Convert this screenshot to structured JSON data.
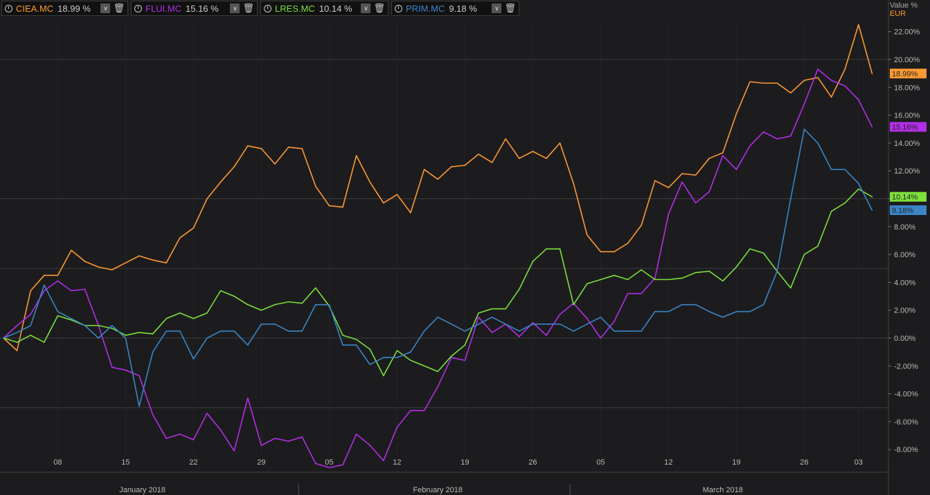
{
  "legend": [
    {
      "symbol": "CIEA.MC",
      "value": "18.99 %",
      "color": "#ff9a32"
    },
    {
      "symbol": "FLUI.MC",
      "value": "15.16 %",
      "color": "#b42ee8"
    },
    {
      "symbol": "LRES.MC",
      "value": "10.14 %",
      "color": "#7ee03c"
    },
    {
      "symbol": "PRIM.MC",
      "value": "9.18 %",
      "color": "#3a86c8"
    }
  ],
  "axis_header": {
    "label": "Value %",
    "currency": "EUR"
  },
  "chart_data": {
    "type": "line",
    "ylabel": "Value %",
    "ylim": [
      -9.5,
      24
    ],
    "yticks": [
      22,
      20,
      18,
      16,
      14,
      12,
      10,
      8,
      6,
      4,
      2,
      0,
      -2,
      -4,
      -6,
      -8
    ],
    "ytick_labels": [
      "22.00%",
      "20.00%",
      "18.00%",
      "16.00%",
      "14.00%",
      "12.00%",
      "10.00%",
      "8.00%",
      "6.00%",
      "4.00%",
      "2.00%",
      "0.00%",
      "-2.00%",
      "-4.00%",
      "-6.00%",
      "-8.00%"
    ],
    "xticks": [
      {
        "i": 4,
        "label": "08"
      },
      {
        "i": 9,
        "label": "15"
      },
      {
        "i": 14,
        "label": "22"
      },
      {
        "i": 19,
        "label": "29"
      },
      {
        "i": 24,
        "label": "05"
      },
      {
        "i": 29,
        "label": "12"
      },
      {
        "i": 34,
        "label": "19"
      },
      {
        "i": 39,
        "label": "26"
      },
      {
        "i": 44,
        "label": "05"
      },
      {
        "i": 49,
        "label": "12"
      },
      {
        "i": 54,
        "label": "19"
      },
      {
        "i": 59,
        "label": "26"
      },
      {
        "i": 63,
        "label": "03"
      }
    ],
    "months": [
      {
        "label": "January 2018",
        "from": 0,
        "to": 22
      },
      {
        "label": "February 2018",
        "from": 22,
        "to": 42
      },
      {
        "label": "March 2018",
        "from": 42,
        "to": 64
      }
    ],
    "series": [
      {
        "name": "CIEA.MC",
        "color": "#ff9a32",
        "last_label": "18.99%",
        "values": [
          0,
          -0.9,
          3.4,
          4.5,
          4.5,
          6.3,
          5.5,
          5.1,
          4.9,
          5.4,
          5.9,
          5.6,
          5.4,
          7.2,
          7.9,
          10.0,
          11.2,
          12.3,
          13.8,
          13.6,
          12.5,
          13.7,
          13.6,
          10.9,
          9.5,
          9.4,
          13.1,
          11.2,
          9.7,
          10.3,
          9.0,
          12.1,
          11.4,
          12.3,
          12.4,
          13.2,
          12.6,
          14.3,
          12.9,
          13.4,
          12.9,
          14.0,
          11.1,
          7.4,
          6.2,
          6.2,
          6.8,
          8.1,
          11.3,
          10.8,
          11.8,
          11.7,
          12.9,
          13.3,
          16.1,
          18.4,
          18.3,
          18.3,
          17.6,
          18.5,
          18.7,
          17.3,
          19.3,
          22.5,
          18.99
        ]
      },
      {
        "name": "FLUI.MC",
        "color": "#b42ee8",
        "last_label": "15.16%",
        "values": [
          0,
          0.9,
          1.7,
          3.4,
          4.1,
          3.4,
          3.5,
          0.9,
          -2.1,
          -2.3,
          -2.7,
          -5.5,
          -7.2,
          -6.9,
          -7.3,
          -5.4,
          -6.6,
          -8.1,
          -4.3,
          -7.7,
          -7.2,
          -7.4,
          -7.1,
          -9.0,
          -9.3,
          -9.1,
          -6.9,
          -7.7,
          -8.8,
          -6.4,
          -5.2,
          -5.2,
          -3.5,
          -1.4,
          -1.6,
          1.5,
          0.4,
          1.0,
          0.1,
          1.1,
          0.2,
          1.7,
          2.5,
          1.4,
          0,
          1.2,
          3.2,
          3.2,
          4.3,
          8.9,
          11.2,
          9.7,
          10.5,
          13.1,
          12.1,
          13.8,
          14.8,
          14.3,
          14.5,
          16.8,
          19.3,
          18.5,
          18.1,
          17.1,
          15.16
        ]
      },
      {
        "name": "LRES.MC",
        "color": "#7ee03c",
        "last_label": "10.14%",
        "values": [
          0,
          -0.3,
          0.2,
          -0.3,
          1.6,
          1.3,
          0.9,
          0.9,
          0.7,
          0.2,
          0.4,
          0.3,
          1.4,
          1.8,
          1.4,
          1.8,
          3.4,
          3.0,
          2.4,
          2.0,
          2.4,
          2.6,
          2.5,
          3.6,
          2.3,
          0.2,
          -0.1,
          -0.8,
          -2.7,
          -0.9,
          -1.6,
          -2.0,
          -2.4,
          -1.3,
          -0.5,
          1.8,
          2.1,
          2.1,
          3.5,
          5.5,
          6.4,
          6.4,
          2.4,
          3.9,
          4.2,
          4.5,
          4.2,
          4.9,
          4.2,
          4.2,
          4.3,
          4.7,
          4.8,
          4.1,
          5.1,
          6.4,
          6.1,
          4.8,
          3.6,
          6.0,
          6.6,
          9.1,
          9.7,
          10.7,
          10.14
        ]
      },
      {
        "name": "PRIM.MC",
        "color": "#3a86c8",
        "last_label": "9.18%",
        "values": [
          0,
          0.4,
          0.9,
          3.8,
          1.9,
          1.4,
          0.9,
          0,
          0.9,
          0,
          -4.9,
          -1.0,
          0.5,
          0.5,
          -1.5,
          0,
          0.5,
          0.5,
          -0.5,
          1.0,
          1.0,
          0.5,
          0.5,
          2.4,
          2.4,
          -0.5,
          -0.5,
          -1.9,
          -1.4,
          -1.4,
          -1.0,
          0.5,
          1.5,
          1.0,
          0.5,
          1.0,
          1.5,
          1.0,
          0.5,
          1.0,
          1.0,
          1.0,
          0.5,
          1.0,
          1.5,
          0.5,
          0.5,
          0.5,
          1.9,
          1.9,
          2.4,
          2.4,
          1.9,
          1.5,
          1.9,
          1.9,
          2.4,
          4.8,
          10.0,
          15.0,
          14.0,
          12.1,
          12.1,
          11.1,
          9.18
        ]
      }
    ]
  }
}
